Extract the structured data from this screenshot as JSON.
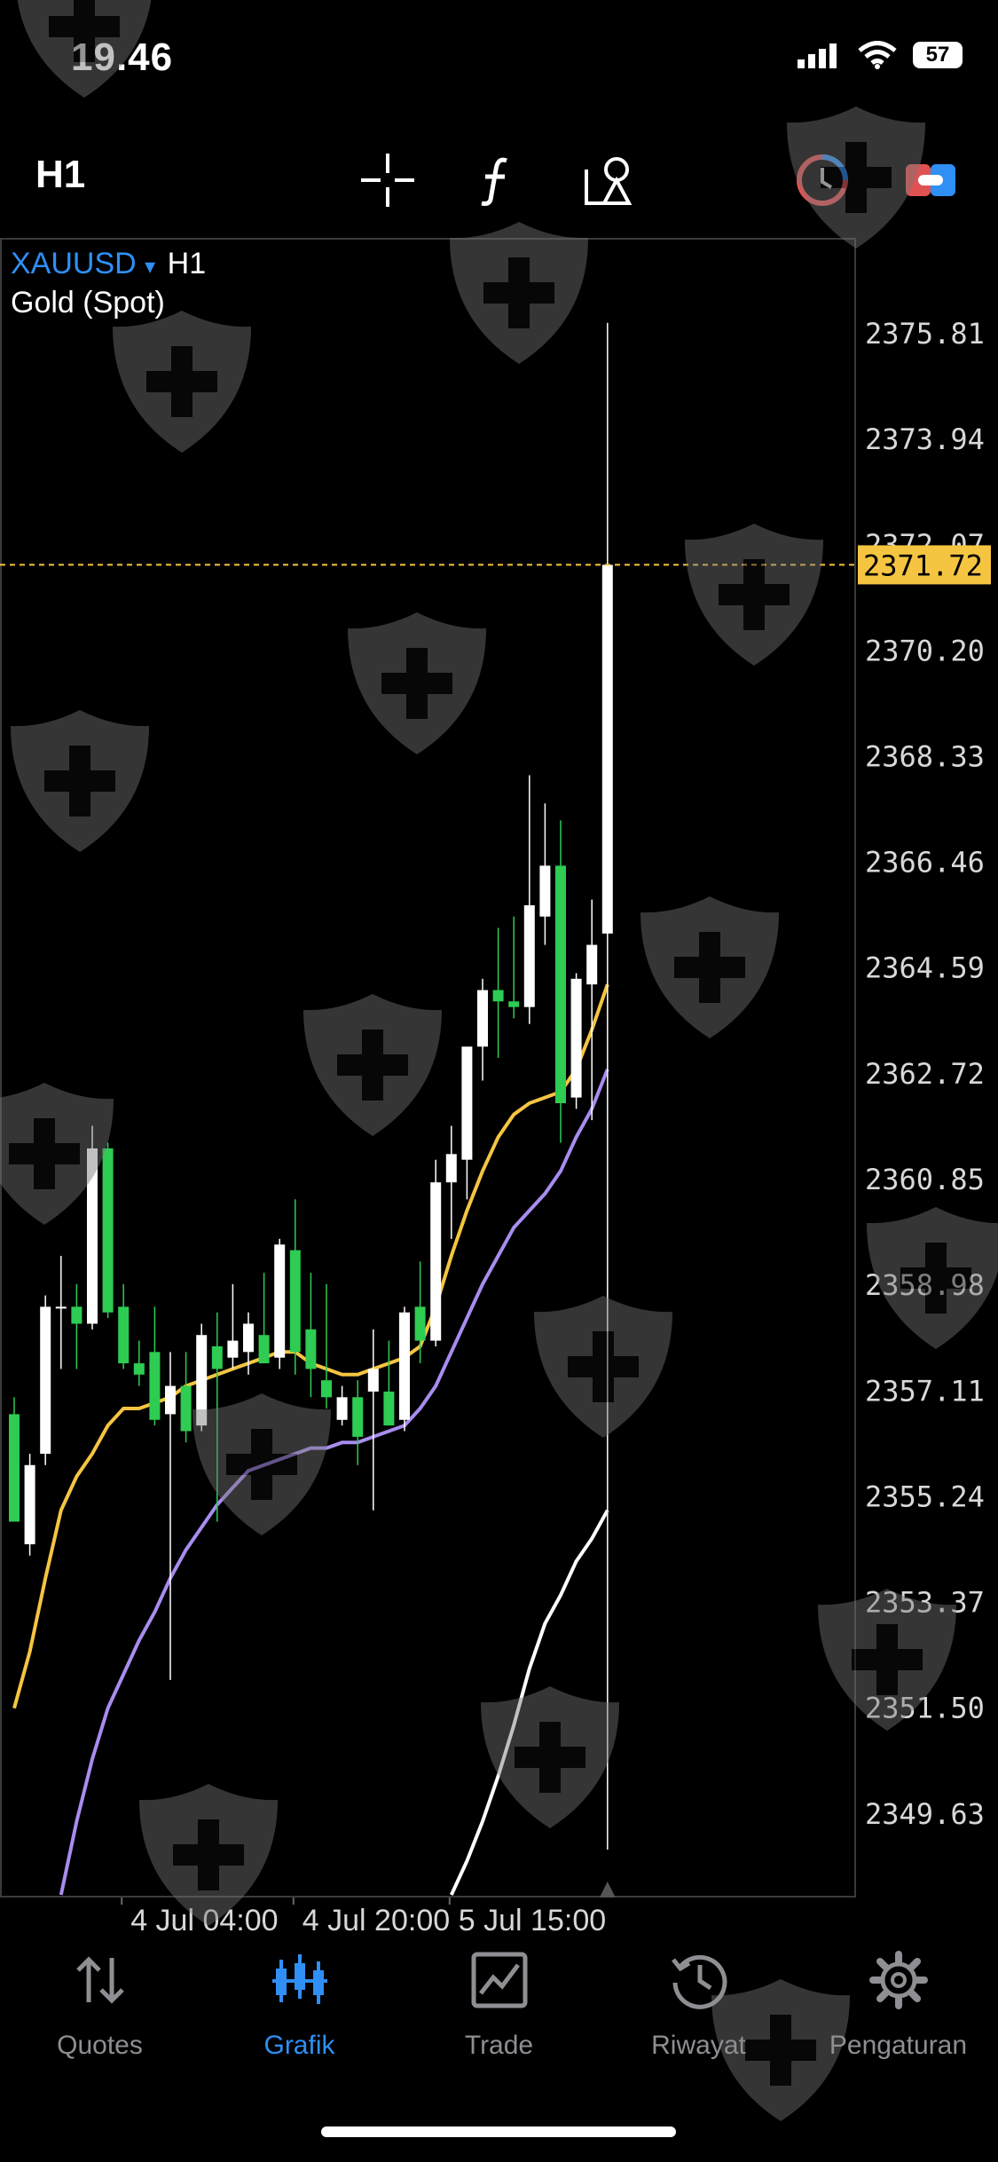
{
  "status": {
    "time": "19.46",
    "battery": "57"
  },
  "toolbar": {
    "timeframe": "H1",
    "icons": [
      "crosshair-icon",
      "function-icon",
      "shapes-icon",
      "clock-icon",
      "toggle-icon"
    ]
  },
  "chart": {
    "symbol": "XAUUSD",
    "symbol_arrow": "▾",
    "timeframe": "H1",
    "instrument": "Gold (Spot)",
    "current_price": "2371.72",
    "price_labels": [
      "2375.81",
      "2373.94",
      "2372.07",
      "2370.20",
      "2368.33",
      "2366.46",
      "2364.59",
      "2362.72",
      "2360.85",
      "2358.98",
      "2357.11",
      "2355.24",
      "2353.37",
      "2351.50",
      "2349.63"
    ],
    "time_labels": [
      "4 Jul 04:00",
      "4 Jul 20:00",
      "5 Jul 15:00"
    ],
    "colors": {
      "bull": "#ffffff",
      "bear": "#2ecc52",
      "ma_fast": "#f5c542",
      "ma_mid": "#a98cf0",
      "ma_slow": "#ffffff",
      "price_line": "#f5c542",
      "accent": "#2f8ff5"
    }
  },
  "chart_data": {
    "type": "candlestick",
    "instrument": "XAUUSD",
    "timeframe": "H1",
    "price_range": [
      2348.2,
      2377.0
    ],
    "last_price": 2371.72,
    "candles": [
      {
        "o": 2356.7,
        "h": 2357.0,
        "l": 2354.8,
        "c": 2354.8
      },
      {
        "o": 2354.4,
        "h": 2356.0,
        "l": 2354.2,
        "c": 2355.8
      },
      {
        "o": 2356.0,
        "h": 2358.8,
        "l": 2355.8,
        "c": 2358.6
      },
      {
        "o": 2358.6,
        "h": 2359.5,
        "l": 2357.5,
        "c": 2358.6
      },
      {
        "o": 2358.6,
        "h": 2359.0,
        "l": 2357.5,
        "c": 2358.3
      },
      {
        "o": 2358.3,
        "h": 2361.8,
        "l": 2358.2,
        "c": 2361.4
      },
      {
        "o": 2361.4,
        "h": 2361.5,
        "l": 2358.4,
        "c": 2358.5
      },
      {
        "o": 2358.6,
        "h": 2359.0,
        "l": 2357.5,
        "c": 2357.6
      },
      {
        "o": 2357.6,
        "h": 2358.0,
        "l": 2357.2,
        "c": 2357.4
      },
      {
        "o": 2357.8,
        "h": 2358.6,
        "l": 2356.5,
        "c": 2356.6
      },
      {
        "o": 2356.7,
        "h": 2357.8,
        "l": 2352.0,
        "c": 2357.2
      },
      {
        "o": 2357.2,
        "h": 2357.8,
        "l": 2356.2,
        "c": 2356.4
      },
      {
        "o": 2356.5,
        "h": 2358.3,
        "l": 2356.4,
        "c": 2358.1
      },
      {
        "o": 2357.9,
        "h": 2358.5,
        "l": 2354.8,
        "c": 2357.5
      },
      {
        "o": 2357.7,
        "h": 2359.0,
        "l": 2357.5,
        "c": 2358.0
      },
      {
        "o": 2357.8,
        "h": 2358.5,
        "l": 2357.4,
        "c": 2358.3
      },
      {
        "o": 2358.1,
        "h": 2359.2,
        "l": 2357.6,
        "c": 2357.6
      },
      {
        "o": 2357.7,
        "h": 2359.8,
        "l": 2357.5,
        "c": 2359.7
      },
      {
        "o": 2359.6,
        "h": 2360.5,
        "l": 2357.4,
        "c": 2357.8
      },
      {
        "o": 2358.2,
        "h": 2359.2,
        "l": 2357.0,
        "c": 2357.5
      },
      {
        "o": 2357.3,
        "h": 2359.0,
        "l": 2356.8,
        "c": 2357.0
      },
      {
        "o": 2356.6,
        "h": 2357.2,
        "l": 2356.5,
        "c": 2357.0
      },
      {
        "o": 2357.0,
        "h": 2357.3,
        "l": 2355.8,
        "c": 2356.3
      },
      {
        "o": 2357.1,
        "h": 2358.2,
        "l": 2355.0,
        "c": 2357.5
      },
      {
        "o": 2357.1,
        "h": 2358.0,
        "l": 2356.5,
        "c": 2356.5
      },
      {
        "o": 2356.6,
        "h": 2358.6,
        "l": 2356.4,
        "c": 2358.5
      },
      {
        "o": 2358.6,
        "h": 2359.4,
        "l": 2357.6,
        "c": 2358.0
      },
      {
        "o": 2358.0,
        "h": 2361.2,
        "l": 2357.9,
        "c": 2360.8
      },
      {
        "o": 2360.8,
        "h": 2361.8,
        "l": 2359.8,
        "c": 2361.3
      },
      {
        "o": 2361.2,
        "h": 2362.2,
        "l": 2360.5,
        "c": 2363.2
      },
      {
        "o": 2363.2,
        "h": 2364.4,
        "l": 2362.6,
        "c": 2364.2
      },
      {
        "o": 2364.2,
        "h": 2365.3,
        "l": 2363.0,
        "c": 2364.0
      },
      {
        "o": 2364.0,
        "h": 2365.5,
        "l": 2363.7,
        "c": 2363.9
      },
      {
        "o": 2363.9,
        "h": 2368.0,
        "l": 2363.6,
        "c": 2365.7
      },
      {
        "o": 2365.5,
        "h": 2367.5,
        "l": 2365.0,
        "c": 2366.4
      },
      {
        "o": 2366.4,
        "h": 2367.2,
        "l": 2361.5,
        "c": 2362.2
      },
      {
        "o": 2362.3,
        "h": 2364.5,
        "l": 2362.1,
        "c": 2364.4
      },
      {
        "o": 2364.3,
        "h": 2365.8,
        "l": 2361.9,
        "c": 2365.0
      },
      {
        "o": 2365.2,
        "h": 2376.0,
        "l": 2349.0,
        "c": 2371.72
      }
    ],
    "moving_averages": [
      {
        "color": "yellow",
        "values": [
          2351.5,
          2352.5,
          2353.8,
          2355.0,
          2355.6,
          2356.0,
          2356.5,
          2356.8,
          2356.8,
          2356.9,
          2357.0,
          2357.2,
          2357.3,
          2357.4,
          2357.5,
          2357.6,
          2357.7,
          2357.8,
          2357.8,
          2357.6,
          2357.5,
          2357.4,
          2357.4,
          2357.5,
          2357.6,
          2357.7,
          2357.9,
          2358.6,
          2359.5,
          2360.3,
          2361.0,
          2361.6,
          2362.0,
          2362.2,
          2362.3,
          2362.4,
          2362.8,
          2363.5,
          2364.3
        ]
      },
      {
        "color": "purple",
        "values": [
          2348.2,
          2349.5,
          2350.6,
          2351.5,
          2352.1,
          2352.7,
          2353.2,
          2353.8,
          2354.3,
          2354.7,
          2355.1,
          2355.4,
          2355.7,
          2355.8,
          2355.9,
          2356.0,
          2356.1,
          2356.1,
          2356.2,
          2356.2,
          2356.3,
          2356.4,
          2356.5,
          2356.8,
          2357.2,
          2357.8,
          2358.4,
          2359.0,
          2359.5,
          2360.0,
          2360.3,
          2360.6,
          2361.0,
          2361.6,
          2362.1,
          2362.8
        ]
      },
      {
        "color": "white",
        "values": [
          2348.2,
          2348.8,
          2349.5,
          2350.3,
          2351.2,
          2352.2,
          2353.0,
          2353.5,
          2354.1,
          2354.5,
          2355.0
        ]
      }
    ]
  },
  "nav": {
    "items": [
      {
        "label": "Quotes",
        "icon": "arrows-updown-icon",
        "active": false
      },
      {
        "label": "Grafik",
        "icon": "candles-icon",
        "active": true
      },
      {
        "label": "Trade",
        "icon": "trade-chart-icon",
        "active": false
      },
      {
        "label": "Riwayat",
        "icon": "history-icon",
        "active": false
      },
      {
        "label": "Pengaturan",
        "icon": "gear-icon",
        "active": false
      }
    ]
  }
}
